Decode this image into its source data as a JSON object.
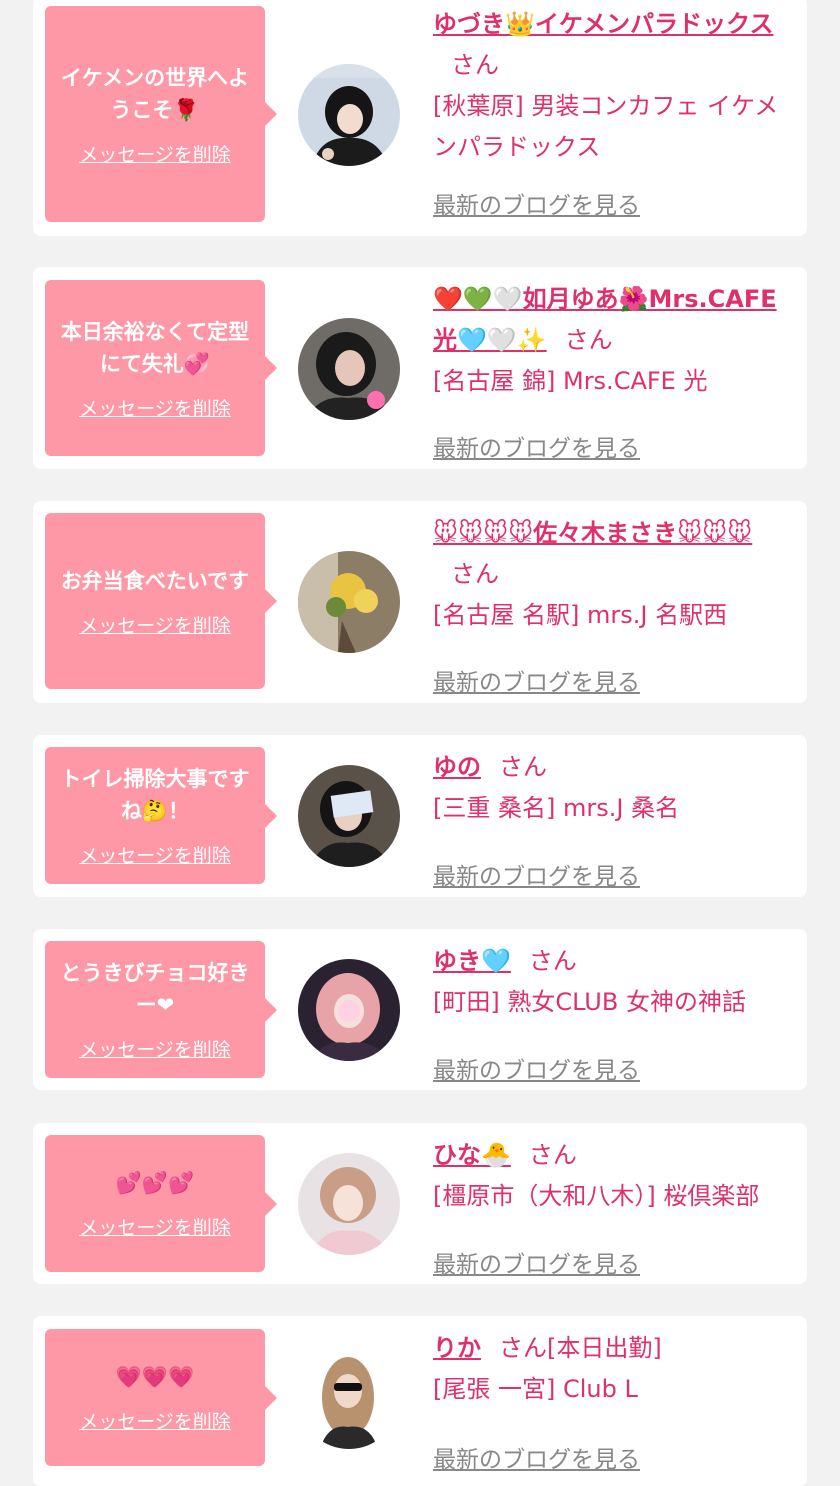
{
  "cards": [
    {
      "bubble_text": "イケメンの世界へようこそ🌹",
      "delete_label": "メッセージを削除",
      "name": "ゆづき👑イケメンパラドックス",
      "san": "さん",
      "status": "",
      "shop": "[秋葉原] 男装コンカフェ イケメンパラドックス",
      "blog_label": "最新のブログを見る"
    },
    {
      "bubble_text": "本日余裕なくて定型にて失礼💞",
      "delete_label": "メッセージを削除",
      "name": "❤️💚🤍如月ゆあ🌺Mrs.CAFE光🩵🤍✨",
      "san": "さん",
      "status": "",
      "shop": "[名古屋 錦] Mrs.CAFE 光",
      "blog_label": "最新のブログを見る"
    },
    {
      "bubble_text": "お弁当食べたいです",
      "delete_label": "メッセージを削除",
      "name": "🐭🐭🐭🐭佐々木まさき🐭🐭🐭",
      "san": "さん",
      "status": "",
      "shop": "[名古屋 名駅] mrs.J 名駅西",
      "blog_label": "最新のブログを見る"
    },
    {
      "bubble_text": "トイレ掃除大事ですね🤔！",
      "delete_label": "メッセージを削除",
      "name": "ゆの",
      "san": "さん",
      "status": "",
      "shop": "[三重 桑名] mrs.J 桑名",
      "blog_label": "最新のブログを見る"
    },
    {
      "bubble_text": "とうきびチョコ好きー❤",
      "delete_label": "メッセージを削除",
      "name": "ゆき🩵",
      "san": "さん",
      "status": "",
      "shop": "[町田] 熟女CLUB 女神の神話",
      "blog_label": "最新のブログを見る"
    },
    {
      "bubble_text": "💕💕💕",
      "delete_label": "メッセージを削除",
      "name": "ひな🐣",
      "san": "さん",
      "status": "",
      "shop": "[橿原市（大和八木）] 桜倶楽部",
      "blog_label": "最新のブログを見る"
    },
    {
      "bubble_text": "💗💗💗",
      "delete_label": "メッセージを削除",
      "name": "りか",
      "san": "さん",
      "status": "[本日出勤]",
      "shop": "[尾張 一宮] Club L",
      "blog_label": "最新のブログを見る"
    }
  ]
}
